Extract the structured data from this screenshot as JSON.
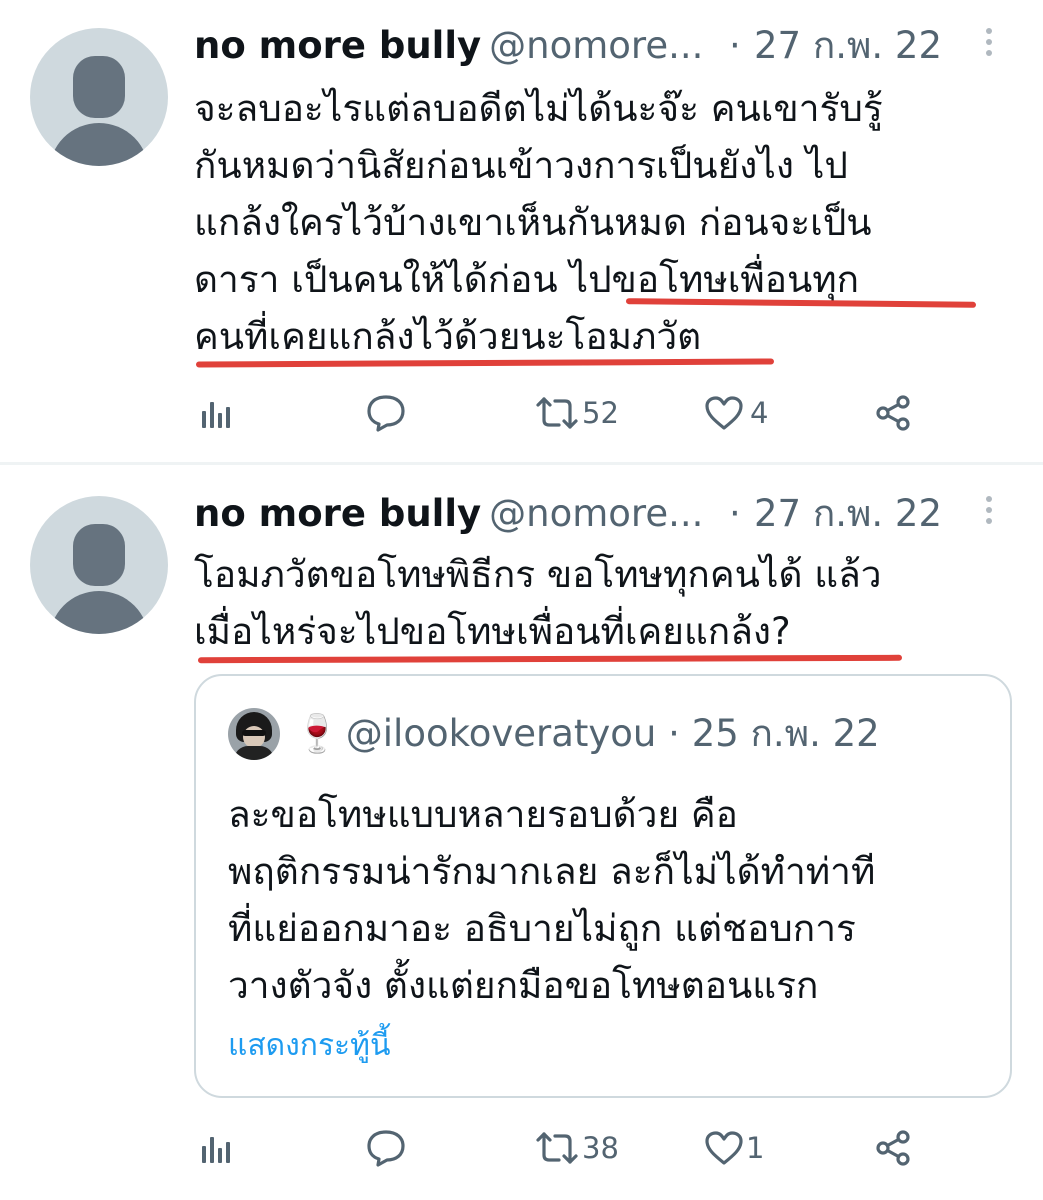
{
  "tweets": [
    {
      "name": "no more bully",
      "handle": "@nomore...",
      "separator": "·",
      "date": "27 ก.พ. 22",
      "lines": [
        "จะลบอะไรแต่ลบอดีตไม่ได้นะจ๊ะ คนเขารับรู้",
        "กันหมดว่านิสัยก่อนเข้าวงการเป็นยังไง ไป",
        "แกล้งใครไว้บ้างเขาเห็นกันหมด ก่อนจะเป็น",
        "ดารา เป็นคนให้ได้ก่อน ไปขอโทษเพื่อนทุก",
        "คนที่เคยแกล้งไว้ด้วยนะโอมภวัต"
      ],
      "retweets": "52",
      "likes": "4"
    },
    {
      "name": "no more bully",
      "handle": "@nomore...",
      "separator": "·",
      "date": "27 ก.พ. 22",
      "lines": [
        "โอมภวัตขอโทษพิธีกร ขอโทษทุกคนได้ แล้ว",
        "เมื่อไหร่จะไปขอโทษเพื่อนที่เคยแกล้ง?"
      ],
      "retweets": "38",
      "likes": "1",
      "quote": {
        "emoji": "🍷",
        "handle": "@ilookoveratyou",
        "separator": "·",
        "date": "25 ก.พ. 22",
        "lines": [
          "ละขอโทษแบบหลายรอบด้วย คือ",
          "พฤติกรรมน่ารักมากเลย ละก็ไม่ได้ทำท่าที",
          "ที่แย่ออกมาอะ อธิบายไม่ถูก แต่ชอบการ",
          "วางตัวจัง ตั้งแต่ยกมือขอโทษตอนแรก"
        ],
        "show_thread": "แสดงกระทู้นี้"
      }
    }
  ],
  "colors": {
    "text": "#0f1419",
    "secondary": "#536471",
    "link": "#1d9bf0",
    "underline_annotation": "#e0413a",
    "avatar_bg": "#cfd9de",
    "avatar_fg": "#66737f"
  },
  "icons": [
    "views-icon",
    "reply-icon",
    "retweet-icon",
    "like-icon",
    "share-icon",
    "more-icon"
  ]
}
